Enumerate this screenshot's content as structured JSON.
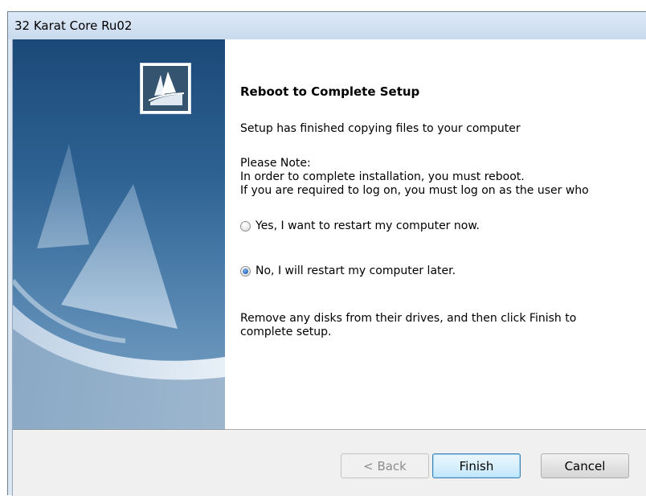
{
  "window": {
    "title": "32 Karat Core Ru02"
  },
  "content": {
    "heading": "Reboot to Complete Setup",
    "finished_text": "Setup has finished copying files to your computer",
    "note_title": "Please Note:",
    "note_line1": "In order to complete installation, you must reboot.",
    "note_line2": "If you are required to log on, you must log on as the user who",
    "options": [
      {
        "label": "Yes, I want to restart my computer now.",
        "checked": false
      },
      {
        "label": "No, I will restart my computer later.",
        "checked": true
      }
    ],
    "remove_disks_text": "Remove any disks from their drives, and then click Finish to complete setup."
  },
  "buttons": {
    "back": "< Back",
    "finish": "Finish",
    "cancel": "Cancel"
  },
  "icons": {
    "logo": "installshield-logo-icon"
  }
}
